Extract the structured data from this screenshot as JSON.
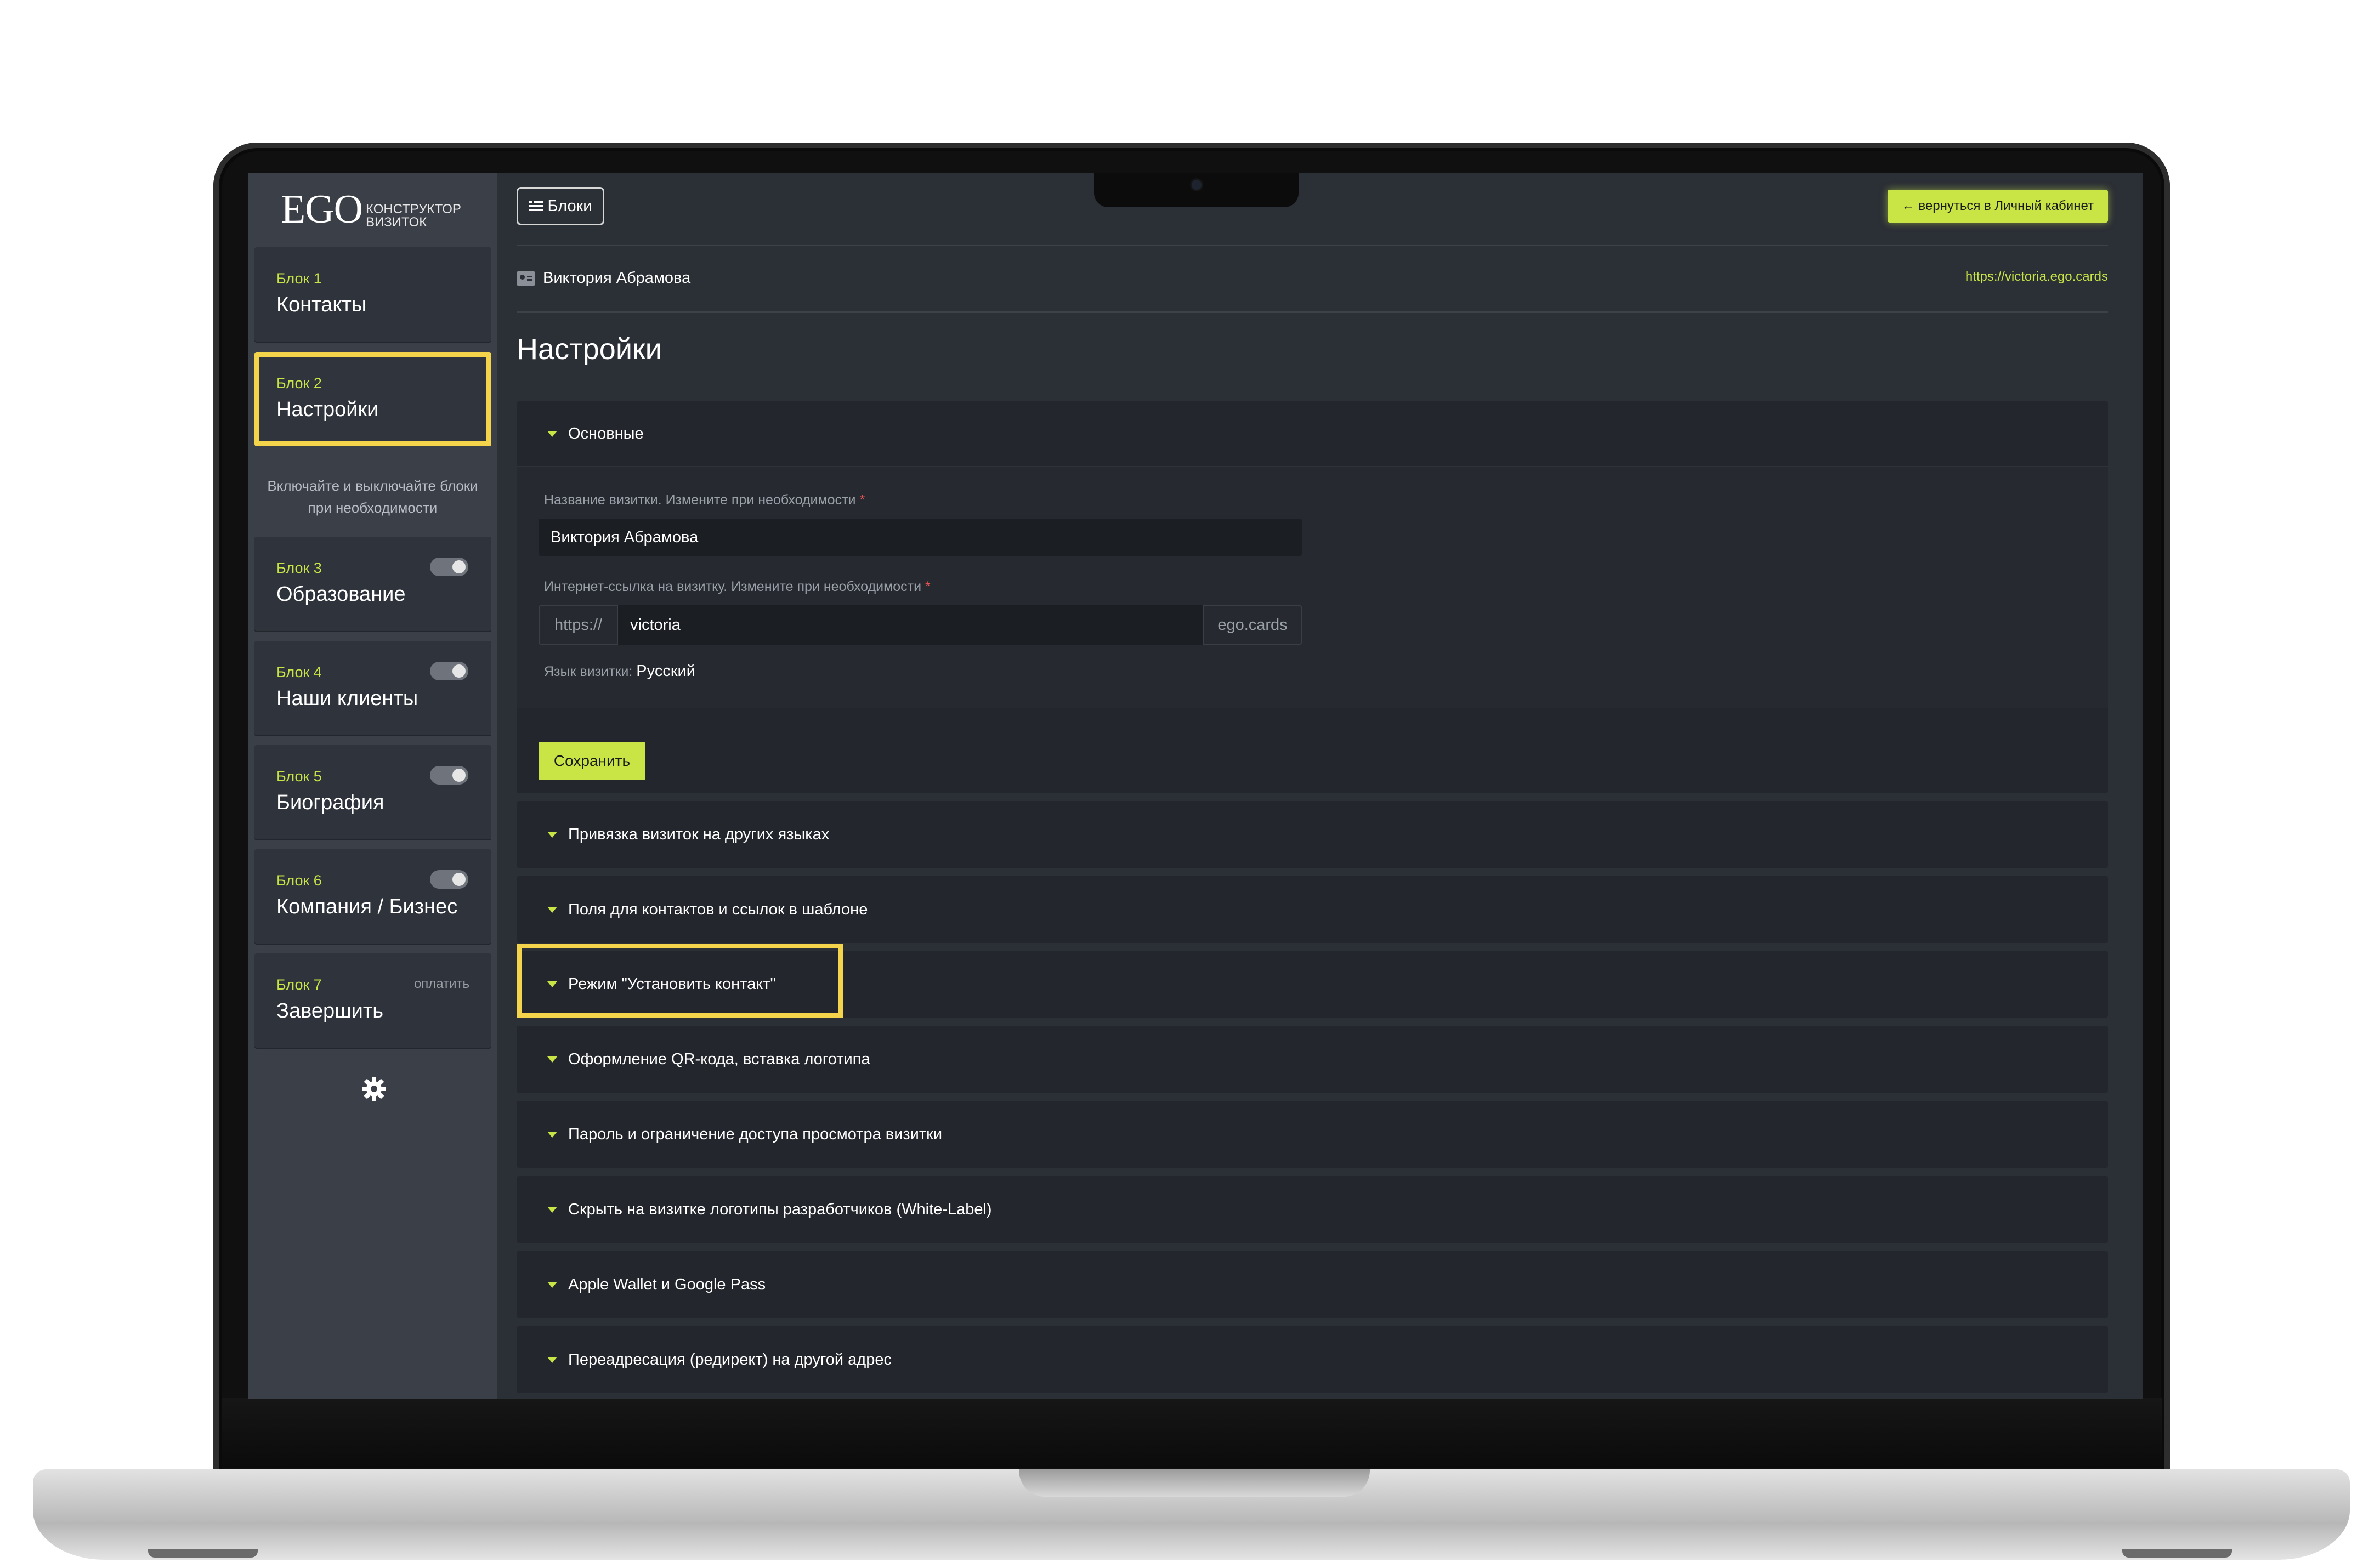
{
  "app": {
    "logo_mark": "EGO",
    "logo_subtitle": "КОНСТРУКТОР ВИЗИТОК"
  },
  "sidebar": {
    "blocks": [
      {
        "num": "Блок 1",
        "title": "Контакты"
      },
      {
        "num": "Блок 2",
        "title": "Настройки",
        "active": true
      },
      {
        "num": "Блок 3",
        "title": "Образование",
        "toggle": true
      },
      {
        "num": "Блок 4",
        "title": "Наши клиенты",
        "toggle": true
      },
      {
        "num": "Блок 5",
        "title": "Биография",
        "toggle": true
      },
      {
        "num": "Блок 6",
        "title": "Компания / Бизнес",
        "toggle": true
      },
      {
        "num": "Блок 7",
        "title": "Завершить",
        "tag": "оплатить"
      }
    ],
    "hint": "Включайте и выключайте блоки при необходимости"
  },
  "toolbar": {
    "blocks_button": "Блоки",
    "back_button": "← вернуться в Личный кабинет"
  },
  "card": {
    "owner": "Виктория Абрамова",
    "url": "https://victoria.ego.cards"
  },
  "page_title": "Настройки",
  "settings": {
    "main_section": "Основные",
    "name_label": "Название визитки. Измените при необходимости",
    "name_value": "Виктория Абрамова",
    "link_label": "Интернет-ссылка на визитку. Измените при необходимости",
    "link_prefix": "https://",
    "link_value": "victoria",
    "link_suffix": "ego.cards",
    "lang_label": "Язык визитки:",
    "lang_value": "Русский",
    "save_button": "Сохранить",
    "required_mark": "*"
  },
  "sections": [
    "Привязка визиток на других языках",
    "Поля для контактов и ссылок в шаблоне",
    "Режим \"Установить контакт\"",
    "Оформление QR-кода, вставка логотипа",
    "Пароль и ограничение доступа просмотра визитки",
    "Скрыть на визитке логотипы разработчиков (White-Label)",
    "Apple Wallet и Google Pass",
    "Переадресация (редирект) на другой адрес"
  ],
  "colors": {
    "accent": "#c8e545",
    "highlight": "#f4d44a"
  }
}
